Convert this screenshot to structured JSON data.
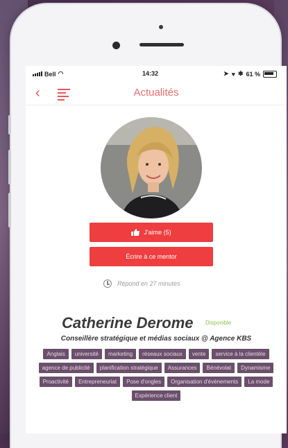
{
  "status_bar": {
    "carrier": "Bell",
    "time": "14:32",
    "battery": "61 %"
  },
  "navbar": {
    "title": "Actualités"
  },
  "profile": {
    "like_label": "J'aime (5)",
    "write_label": "Écrire à ce mentor",
    "response_time": "Répond en 27 minutes",
    "name": "Catherine Derome",
    "availability": "Disponible",
    "subtitle": "Conseillère stratégique et médias sociaux @ Agence KBS"
  },
  "tags": [
    "Anglais",
    "université",
    "marketing",
    "réseaux sociaux",
    "vente",
    "service à la clientèle",
    "agence de publicité",
    "planification stratégique",
    "Assurances",
    "Bénévolat",
    "Dynamisme",
    "Proactivité",
    "Entrepreneuriat",
    "Pose d'ongles",
    "Organisation d'évènements",
    "La mode",
    "Expérience client"
  ],
  "colors": {
    "accent": "#ee3e3f",
    "tag_bg": "#6b4f6b",
    "available": "#8bc34a"
  }
}
